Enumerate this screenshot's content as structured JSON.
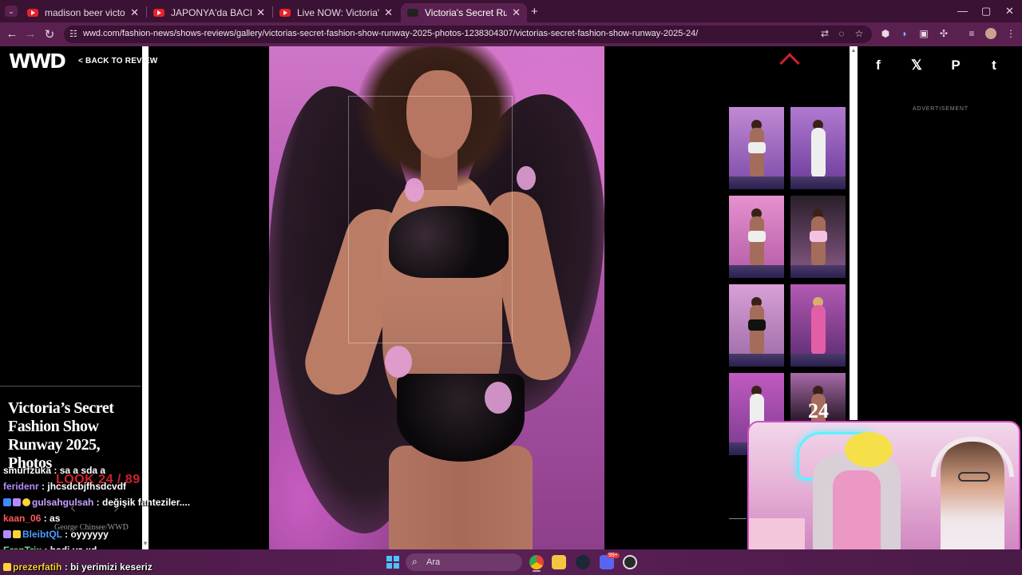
{
  "browser": {
    "tabs": [
      {
        "title": "madison beer victorias secret fa",
        "icon": "youtube-icon"
      },
      {
        "title": "JAPONYA'da BACIM İLE SOKAK",
        "icon": "youtube-icon"
      },
      {
        "title": "Live NOW: Victoria's Secret Fas",
        "icon": "youtube-icon"
      },
      {
        "title": "Victoria's Secret Runway, Fashio",
        "icon": "wwd-icon",
        "active": true
      }
    ],
    "new_tab": "+",
    "window_controls": [
      "—",
      "▢",
      "✕"
    ],
    "url": "wwd.com/fashion-news/shows-reviews/gallery/victorias-secret-fashion-show-runway-2025-photos-1238304307/victorias-secret-fashion-show-runway-2025-24/"
  },
  "page": {
    "logo": "WWD",
    "back_link": "< BACK TO REVIEW",
    "gallery_title": "Victoria’s Secret Fashion Show Runway 2025, Photos",
    "look_label": "LOOK 24 / 89",
    "photo_credit": "George Chinsee/WWD",
    "current_index": "24",
    "advertisement": "ADVERTISEMENT",
    "share": [
      {
        "label": "f",
        "icon": "facebook-icon"
      },
      {
        "label": "𝕏",
        "icon": "x-icon"
      },
      {
        "label": "P",
        "icon": "pinterest-icon"
      },
      {
        "label": "t",
        "icon": "tumblr-icon"
      }
    ]
  },
  "chat": [
    {
      "user": "smurfzuka",
      "msg": "sa a sda a",
      "color": "#ffffff"
    },
    {
      "user": "feridenr",
      "msg": "jhcsdcbjfhsdcvdf",
      "color": "#b58cff"
    },
    {
      "user": "gulsahgulsah",
      "msg": "değişik fanteziler....",
      "color": "#c9a0ff"
    },
    {
      "user": "kaan_06",
      "msg": "as",
      "color": "#ff5a5a"
    },
    {
      "user": "BleibtQL",
      "msg": "oyyyyyy",
      "color": "#4f9bff"
    },
    {
      "user": "ErenTrix",
      "msg": "hadi ya xd",
      "color": "#6fe07a"
    },
    {
      "user": "prezerfatih",
      "msg": "bi yerimizi keseriz",
      "color": "#ffd23a"
    }
  ],
  "taskbar": {
    "search_placeholder": "Ara",
    "notification_count": "99+"
  },
  "colors": {
    "chrome_bg": "#3a1233",
    "toolbar_bg": "#5a2150",
    "accent_red": "#d21f2c",
    "taskbar_bg": "#4a1a47"
  }
}
